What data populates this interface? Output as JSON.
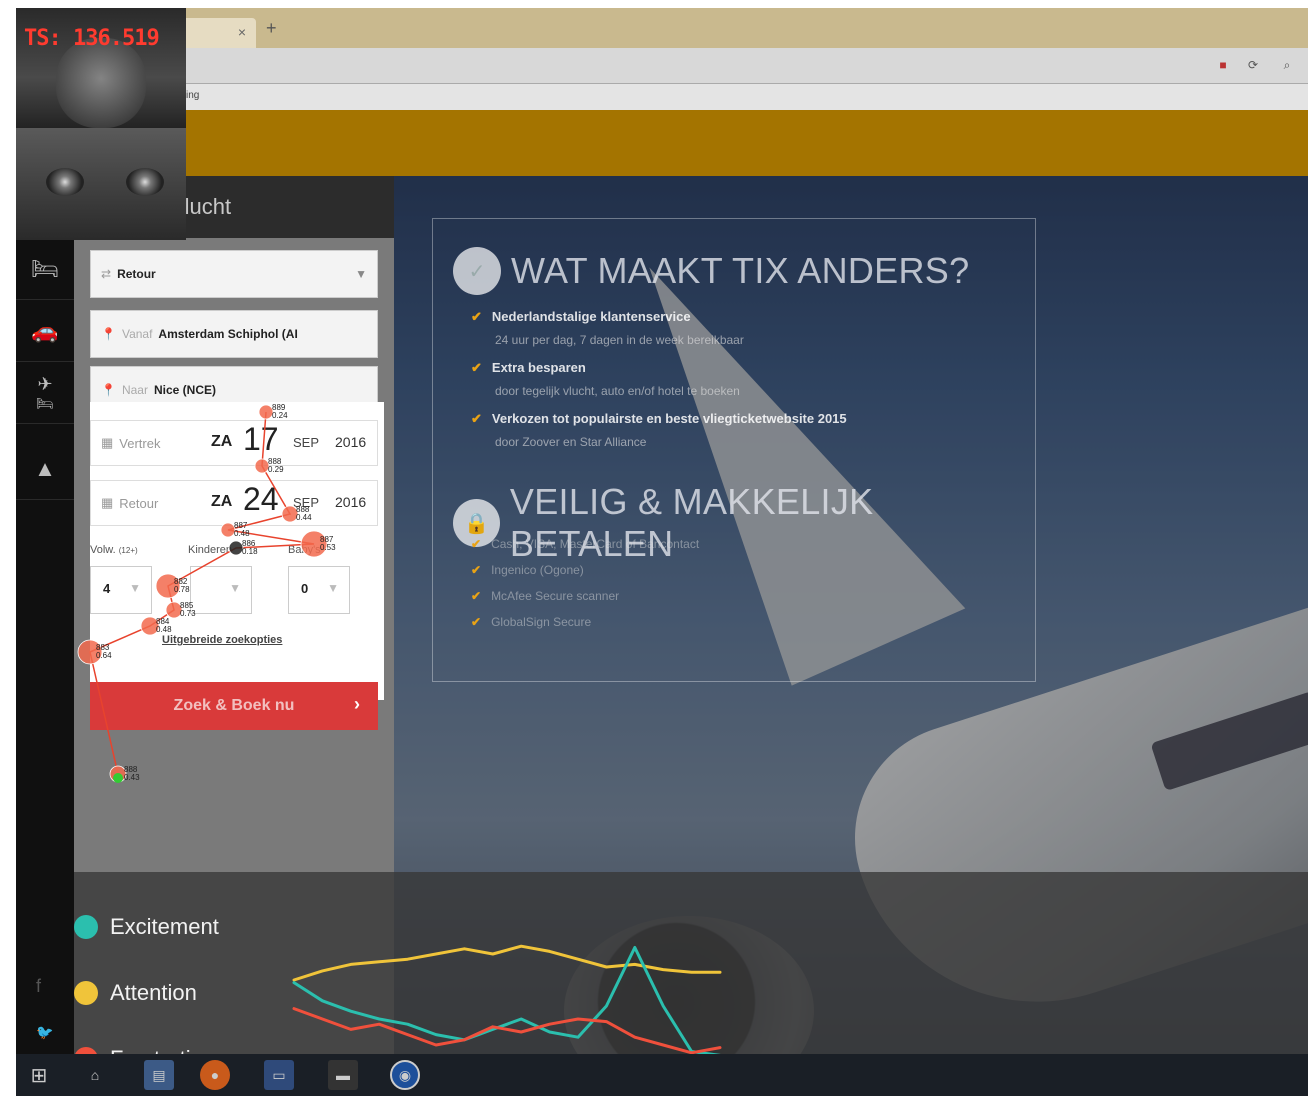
{
  "timestamp": "TS: 136.519",
  "browser": {
    "tab_close": "×",
    "new_tab": "+",
    "bookmark_text": "ing"
  },
  "left_nav": {
    "items": [
      "hotel-icon",
      "car-icon",
      "flight-hotel-icon",
      "tours-icon"
    ],
    "social": [
      "f",
      "🐦"
    ]
  },
  "form": {
    "header": "Vlucht",
    "trip_type": "Retour",
    "from_label": "Vanaf",
    "from_value": "Amsterdam Schiphol (AI",
    "to_label": "Naar",
    "to_value": "Nice (NCE)",
    "depart": {
      "label": "Vertrek",
      "weekday": "ZA",
      "day": "17",
      "month": "SEP",
      "year": "2016"
    },
    "return": {
      "label": "Retour",
      "weekday": "ZA",
      "day": "24",
      "month": "SEP",
      "year": "2016"
    },
    "adults_label": "Volw.",
    "adults_sub": "(12+)",
    "kids_label": "Kinderen",
    "babies_label": "Baby's",
    "adults": "4",
    "babies": "0",
    "advanced_link": "Uitgebreide zoekopties",
    "search_button": "Zoek & Boek nu",
    "search_arrow": "›"
  },
  "info": {
    "heading1": "WAT MAAKT TIX ANDERS?",
    "items": [
      {
        "title": "Nederlandstalige klantenservice",
        "sub": "24 uur per dag, 7 dagen in de week bereikbaar"
      },
      {
        "title": "Extra besparen",
        "sub": "door tegelijk vlucht, auto en/of hotel te boeken"
      },
      {
        "title": "Verkozen tot populairste en beste vliegticketwebsite 2015",
        "sub": "door Zoover en Star Alliance"
      }
    ],
    "heading2": "VEILIG & MAKKELIJK BETALEN",
    "payments": [
      "Cash, VISA, MasterCard of Bancontact",
      "Ingenico (Ogone)",
      "McAfee Secure scanner",
      "GlobalSign Secure"
    ]
  },
  "legend": {
    "excitement": "Excitement",
    "attention": "Attention",
    "frustration": "Frustration"
  },
  "colors": {
    "excitement": "#2bbfae",
    "attention": "#f0c43a",
    "frustration": "#f0503c",
    "brand": "#a47400",
    "search": "#d93a3a",
    "gaze": "#e8432d"
  },
  "gaze_points": [
    {
      "n": "889",
      "v": "0.24"
    },
    {
      "n": "888",
      "v": "0.29"
    },
    {
      "n": "888",
      "v": "0.44"
    },
    {
      "n": "887",
      "v": "0.48"
    },
    {
      "n": "887",
      "v": "0.53"
    },
    {
      "n": "886",
      "v": "0.18"
    },
    {
      "n": "882",
      "v": "0.78"
    },
    {
      "n": "885",
      "v": "0.73"
    },
    {
      "n": "884",
      "v": "0.48"
    },
    {
      "n": "883",
      "v": "0.64"
    },
    {
      "n": "888",
      "v": "0.43"
    }
  ],
  "emotion_series": {
    "attention": [
      0.6,
      0.67,
      0.72,
      0.74,
      0.76,
      0.8,
      0.84,
      0.8,
      0.86,
      0.82,
      0.76,
      0.7,
      0.72,
      0.68,
      0.66,
      0.66
    ],
    "excitement": [
      0.58,
      0.44,
      0.36,
      0.3,
      0.26,
      0.18,
      0.14,
      0.22,
      0.3,
      0.2,
      0.16,
      0.4,
      0.85,
      0.4,
      0.05,
      0.02
    ],
    "frustration": [
      0.38,
      0.3,
      0.22,
      0.26,
      0.18,
      0.1,
      0.14,
      0.24,
      0.2,
      0.26,
      0.3,
      0.28,
      0.16,
      0.1,
      0.04,
      0.08
    ]
  }
}
